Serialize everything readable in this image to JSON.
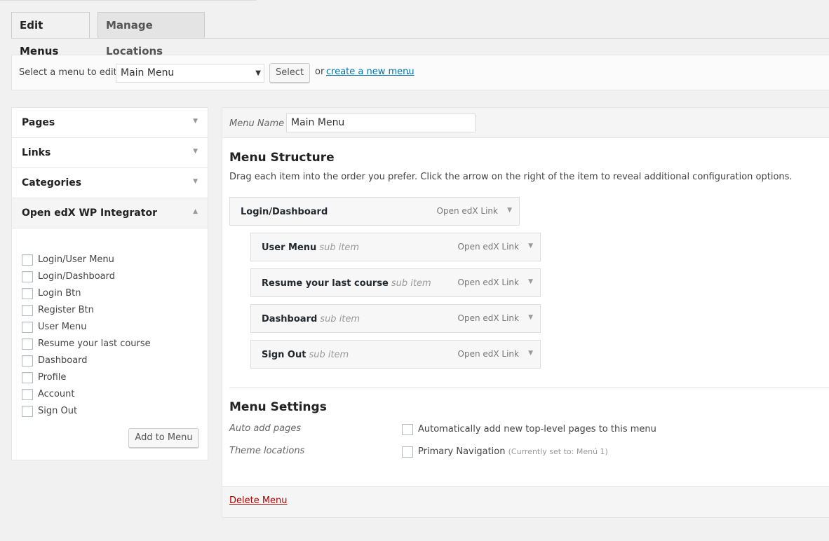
{
  "tabs": [
    {
      "label": "Edit Menus",
      "active": true
    },
    {
      "label": "Manage Locations",
      "active": false
    }
  ],
  "manage": {
    "label": "Select a menu to edit:",
    "selected_menu": "Main Menu",
    "select_button": "Select",
    "or_text": "or",
    "create_link": "create a new menu",
    "period": "."
  },
  "sidebar": {
    "sections": [
      {
        "title": "Pages"
      },
      {
        "title": "Links"
      },
      {
        "title": "Categories"
      },
      {
        "title": "Open edX WP Integrator"
      }
    ],
    "integrator_items": [
      "Login/User Menu",
      "Login/Dashboard",
      "Login Btn",
      "Register Btn",
      "User Menu",
      "Resume your last course",
      "Dashboard",
      "Profile",
      "Account",
      "Sign Out"
    ],
    "add_button": "Add to Menu"
  },
  "menu": {
    "name_label": "Menu Name",
    "name_value": "Main Menu",
    "structure_title": "Menu Structure",
    "structure_desc": "Drag each item into the order you prefer. Click the arrow on the right of the item to reveal additional configuration options.",
    "items": [
      {
        "title": "Login/Dashboard",
        "sub": "",
        "type": "Open edX Link"
      },
      {
        "title": "User Menu",
        "sub": "sub item",
        "type": "Open edX Link"
      },
      {
        "title": "Resume your last course",
        "sub": "sub item",
        "type": "Open edX Link"
      },
      {
        "title": "Dashboard",
        "sub": "sub item",
        "type": "Open edX Link"
      },
      {
        "title": "Sign Out",
        "sub": "sub item",
        "type": "Open edX Link"
      }
    ],
    "settings_title": "Menu Settings",
    "auto_add_label": "Auto add pages",
    "auto_add_text": "Automatically add new top-level pages to this menu",
    "theme_locations_label": "Theme locations",
    "primary_nav_text": "Primary Navigation",
    "primary_nav_note": "(Currently set to: Menú 1)",
    "delete_link": "Delete Menu"
  },
  "colors": {
    "link": "#0073aa",
    "delete": "#aa0000",
    "background": "#f1f1f1"
  }
}
